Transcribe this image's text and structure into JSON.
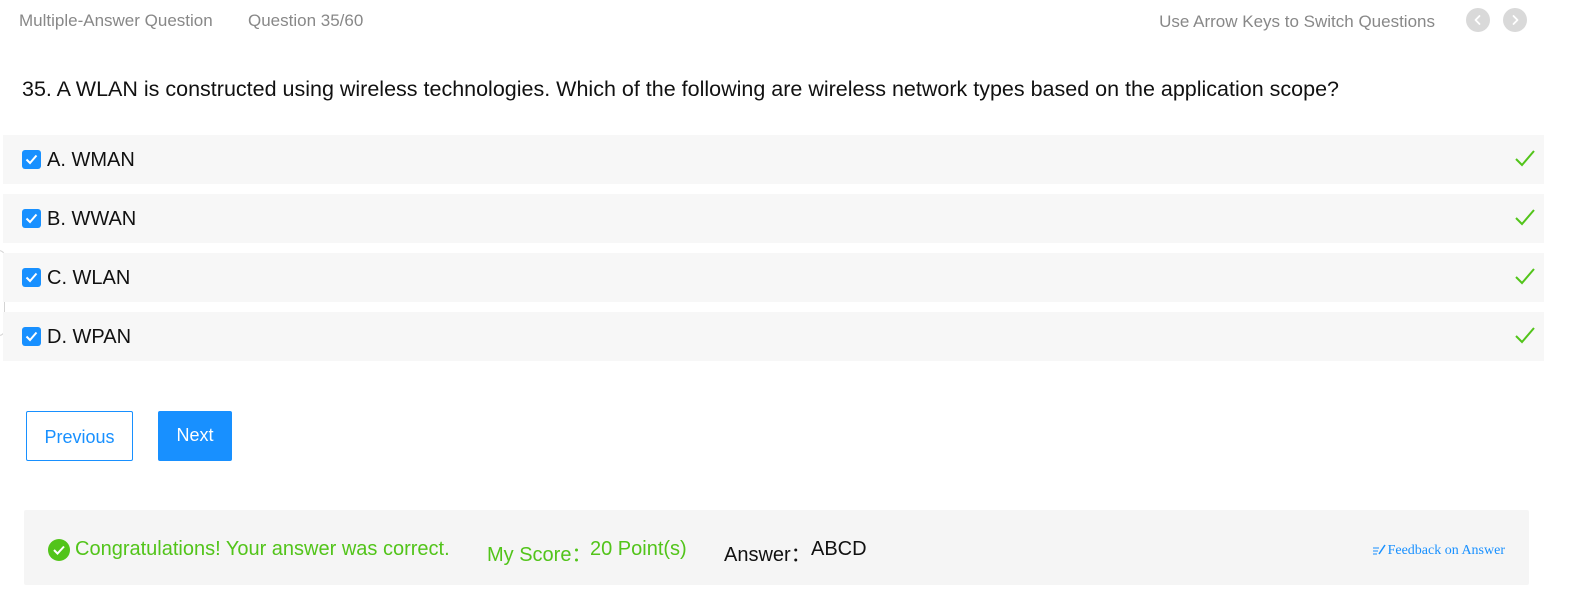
{
  "header": {
    "question_type": "Multiple-Answer Question",
    "question_count": "Question 35/60",
    "hint": "Use Arrow Keys to Switch Questions"
  },
  "question": {
    "text": "35. A WLAN is constructed using wireless technologies. Which of the following are wireless network types based on the application scope?"
  },
  "options": [
    {
      "label": "A. WMAN",
      "checked": true,
      "correct": true
    },
    {
      "label": "B. WWAN",
      "checked": true,
      "correct": true
    },
    {
      "label": "C. WLAN",
      "checked": true,
      "correct": true
    },
    {
      "label": "D. WPAN",
      "checked": true,
      "correct": true
    }
  ],
  "buttons": {
    "previous": "Previous",
    "next": "Next"
  },
  "result": {
    "message": "Congratulations! Your answer was correct.",
    "score_label": "My Score：",
    "score_value": "20 Point(s)",
    "answer_label": "Answer：",
    "answer_value": "ABCD",
    "feedback_link": "Feedback on Answer"
  },
  "colors": {
    "accent": "#1890ff",
    "success": "#52c41a",
    "muted_text": "#888888",
    "option_bg": "#f7f7f7",
    "result_bg": "#f5f5f5"
  },
  "icons": {
    "nav_prev": "chevron-left-icon",
    "nav_next": "chevron-right-icon",
    "checkbox": "checkbox-checked-icon",
    "correct": "checkmark-icon",
    "success": "check-circle-icon",
    "feedback": "edit-icon"
  }
}
